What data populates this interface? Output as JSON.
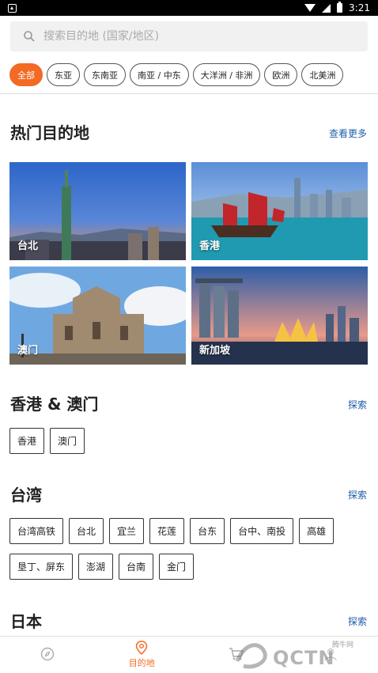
{
  "status_bar": {
    "time": "3:21"
  },
  "search": {
    "placeholder": "搜索目的地 (国家/地区)"
  },
  "regions": [
    "全部",
    "东亚",
    "东南亚",
    "南亚 / 中东",
    "大洋洲 / 非洲",
    "欧洲",
    "北美洲"
  ],
  "popular": {
    "title": "热门目的地",
    "more_label": "查看更多",
    "tiles": [
      "台北",
      "香港",
      "澳门",
      "新加坡"
    ]
  },
  "hk_macau": {
    "title": "香港 & 澳门",
    "explore_label": "探索",
    "tags": [
      "香港",
      "澳门"
    ]
  },
  "taiwan": {
    "title": "台湾",
    "explore_label": "探索",
    "tags": [
      "台湾高铁",
      "台北",
      "宜兰",
      "花莲",
      "台东",
      "台中、南投",
      "高雄",
      "垦丁、屏东",
      "澎湖",
      "台南",
      "金门"
    ]
  },
  "japan": {
    "title": "日本",
    "explore_label": "探索"
  },
  "bottom_nav": {
    "active_label": "目的地"
  },
  "watermark": {
    "main": "QCTN",
    "small": "腾牛网"
  },
  "colors": {
    "accent": "#f26a24",
    "link": "#1f5fa8"
  }
}
